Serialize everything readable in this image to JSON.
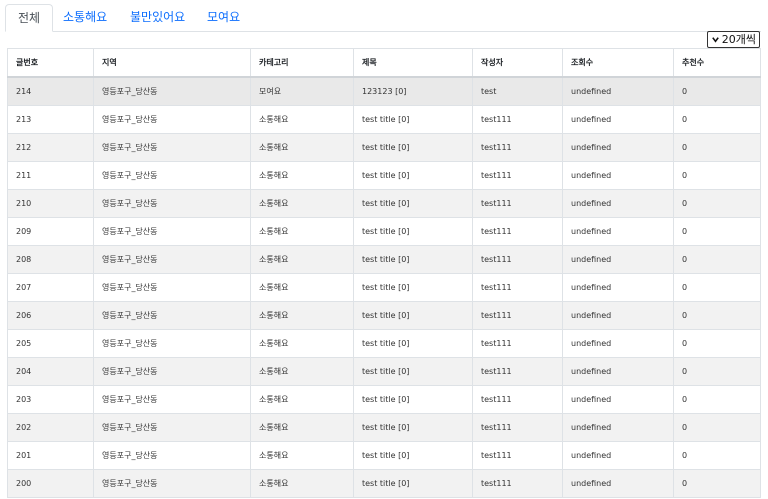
{
  "tabs": [
    {
      "label": "전체",
      "active": true
    },
    {
      "label": "소통해요",
      "active": false
    },
    {
      "label": "불만있어요",
      "active": false
    },
    {
      "label": "모여요",
      "active": false
    }
  ],
  "page_size": {
    "label": "20개씩",
    "icon": "chevron-down-icon"
  },
  "table": {
    "headers": [
      "글번호",
      "지역",
      "카테고리",
      "제목",
      "작성자",
      "조회수",
      "추천수"
    ],
    "rows": [
      [
        "214",
        "영등포구_당산동",
        "모여요",
        "123123 [0]",
        "test",
        "undefined",
        "0"
      ],
      [
        "213",
        "영등포구_당산동",
        "소통해요",
        "test title [0]",
        "test111",
        "undefined",
        "0"
      ],
      [
        "212",
        "영등포구_당산동",
        "소통해요",
        "test title [0]",
        "test111",
        "undefined",
        "0"
      ],
      [
        "211",
        "영등포구_당산동",
        "소통해요",
        "test title [0]",
        "test111",
        "undefined",
        "0"
      ],
      [
        "210",
        "영등포구_당산동",
        "소통해요",
        "test title [0]",
        "test111",
        "undefined",
        "0"
      ],
      [
        "209",
        "영등포구_당산동",
        "소통해요",
        "test title [0]",
        "test111",
        "undefined",
        "0"
      ],
      [
        "208",
        "영등포구_당산동",
        "소통해요",
        "test title [0]",
        "test111",
        "undefined",
        "0"
      ],
      [
        "207",
        "영등포구_당산동",
        "소통해요",
        "test title [0]",
        "test111",
        "undefined",
        "0"
      ],
      [
        "206",
        "영등포구_당산동",
        "소통해요",
        "test title [0]",
        "test111",
        "undefined",
        "0"
      ],
      [
        "205",
        "영등포구_당산동",
        "소통해요",
        "test title [0]",
        "test111",
        "undefined",
        "0"
      ],
      [
        "204",
        "영등포구_당산동",
        "소통해요",
        "test title [0]",
        "test111",
        "undefined",
        "0"
      ],
      [
        "203",
        "영등포구_당산동",
        "소통해요",
        "test title [0]",
        "test111",
        "undefined",
        "0"
      ],
      [
        "202",
        "영등포구_당산동",
        "소통해요",
        "test title [0]",
        "test111",
        "undefined",
        "0"
      ],
      [
        "201",
        "영등포구_당산동",
        "소통해요",
        "test title [0]",
        "test111",
        "undefined",
        "0"
      ],
      [
        "200",
        "영등포구_당산동",
        "소통해요",
        "test title [0]",
        "test111",
        "undefined",
        "0"
      ]
    ]
  }
}
